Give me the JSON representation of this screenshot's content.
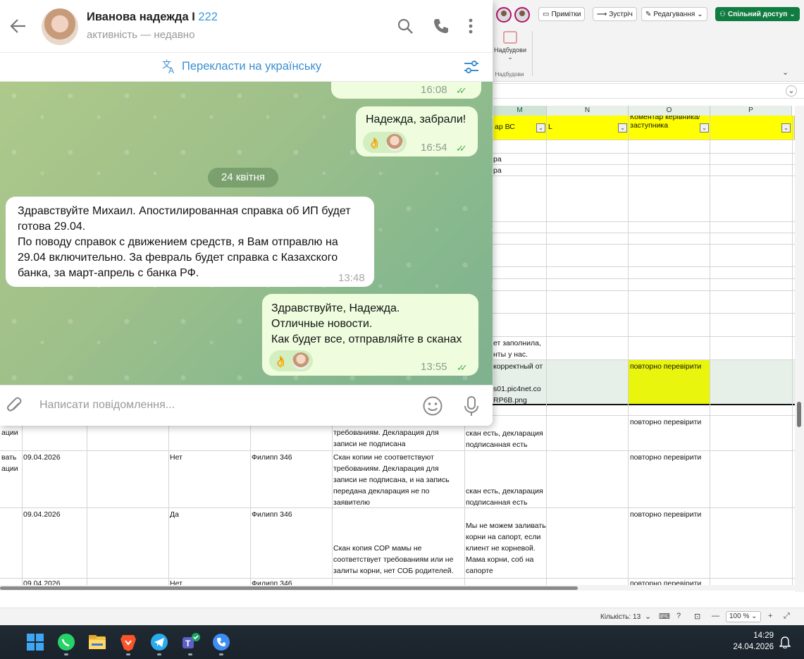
{
  "telegram": {
    "contact_name": "Иванова надежда I",
    "contact_number": "222",
    "status": "активність — недавно",
    "translate_label": "Перекласти на українську",
    "date_divider": "24 квітня",
    "input_placeholder": "Написати повідомлення...",
    "messages": [
      {
        "direction": "out",
        "time": "16:08",
        "reaction": "👌"
      },
      {
        "direction": "out",
        "text": "Надежда, забрали!",
        "time": "16:54",
        "reaction": "👌"
      },
      {
        "direction": "in",
        "lines": [
          "Здравствуйте Михаил. Апостилированная справка об ИП будет",
          "готова 29.04.",
          "По поводу справок с движением средств, я Вам отправлю на",
          "29.04 включительно. За февраль будет справка с Казахского",
          "банка, за март-апрель с банка РФ."
        ],
        "time": "13:48"
      },
      {
        "direction": "out",
        "lines": [
          "Здравствуйте, Надежда.",
          "Отличные новости.",
          "Как будет все, отправляйте в сканах"
        ],
        "time": "13:55",
        "reaction": "👌"
      }
    ]
  },
  "excel": {
    "buttons": {
      "notes": "Примітки",
      "meeting": "Зустріч",
      "editing": "Редагування",
      "share": "Спільний доступ"
    },
    "addins_label": "Надбудови",
    "addins_group": "Надбудови",
    "columns": [
      "M",
      "N",
      "O",
      "P"
    ],
    "header_cells": {
      "m": "ар ВС",
      "n": "L",
      "o": "Коментар керівника/заступника"
    },
    "frag": {
      "r1": "ра",
      "r2": "ра",
      "r3a": "ет заполнила,",
      "r3b": "нты у нас.",
      "sel_a": "корректный от",
      "sel_b": "s01.pic4net.co",
      "sel_c": "RP6B.png",
      "sel_o": "повторно перевірити"
    },
    "rows": [
      {
        "a": "ации",
        "e": "Скан копии не соответствуют требованиям. Декларация для записи не подписана",
        "f": "скан есть, декларация подписанная есть",
        "o": "повторно перевірити"
      },
      {
        "a1": "вать",
        "a2": "ации",
        "b": "09.04.2026",
        "d": "Нет",
        "e_name": "Филипп 346",
        "e": "Скан копии не соответствуют требованиям. Декларация для записи не подписана, и на запись передана декларация не по заявителю",
        "f": "скан есть, декларация подписанная есть",
        "o": "повторно перевірити"
      },
      {
        "b": "09.04.2026",
        "d": "Да",
        "e_name": "Филипп 346",
        "e": "Скан копия СОР мамы не соответствует требованиям или не залиты корни, нет СОБ родителей.",
        "f": "Мы не можем заливать корни на сапорт, если клиент не корневой. Мама корни, соб на сапорте",
        "o": "повторно перевірити"
      },
      {
        "b": "09.04.2026",
        "d": "Нет",
        "e_name": "Филипп 346",
        "o": "повторно перевірити"
      }
    ],
    "status": {
      "count": "Кількість: 13",
      "zoom": "100 %"
    }
  },
  "taskbar": {
    "time": "14:29",
    "date": "24.04.2026",
    "apps": [
      "windows-start",
      "whatsapp",
      "file-explorer",
      "brave-browser",
      "telegram",
      "teams",
      "phone-link"
    ]
  }
}
